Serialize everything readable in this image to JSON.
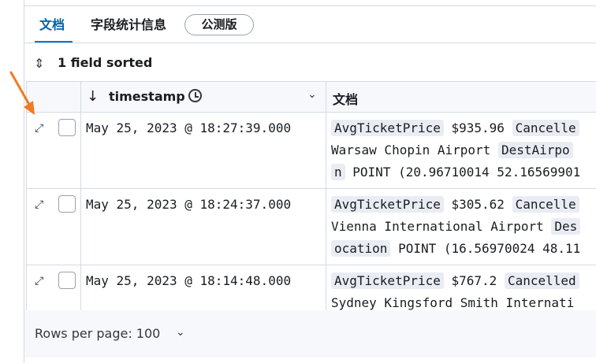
{
  "tabs": [
    {
      "label": "文档",
      "active": true
    },
    {
      "label": "字段统计信息",
      "active": false
    }
  ],
  "badge": "公测版",
  "sort": {
    "icon": "sort-icon",
    "label": "1 field sorted"
  },
  "grid": {
    "timestamp_header": "timestamp",
    "document_header": "文档",
    "rows": [
      {
        "timestamp": "May 25, 2023 @ 18:27:39.000",
        "doc_key1": "AvgTicketPrice",
        "doc_val1": "$935.96",
        "doc_key2": "Cancelle",
        "doc_line2a": "Warsaw Chopin Airport",
        "doc_key3": "DestAirpo",
        "doc_line3a": "n",
        "doc_line3b": "POINT (20.96710014 52.16569901"
      },
      {
        "timestamp": "May 25, 2023 @ 18:24:37.000",
        "doc_key1": "AvgTicketPrice",
        "doc_val1": "$305.62",
        "doc_key2": "Cancelle",
        "doc_line2a": "Vienna International Airport",
        "doc_key3": "Des",
        "doc_line3a": "ocation",
        "doc_line3b": "POINT (16.56970024 48.11"
      },
      {
        "timestamp": "May 25, 2023 @ 18:14:48.000",
        "doc_key1": "AvgTicketPrice",
        "doc_val1": "$767.2",
        "doc_key2": "Cancelled",
        "doc_line2a": "Sydney Kingsford Smith Internati"
      }
    ]
  },
  "footer": {
    "rows_per_page": "Rows per page: 100"
  },
  "colors": {
    "accent": "#0077cc",
    "annotation_arrow": "#f07b21"
  }
}
